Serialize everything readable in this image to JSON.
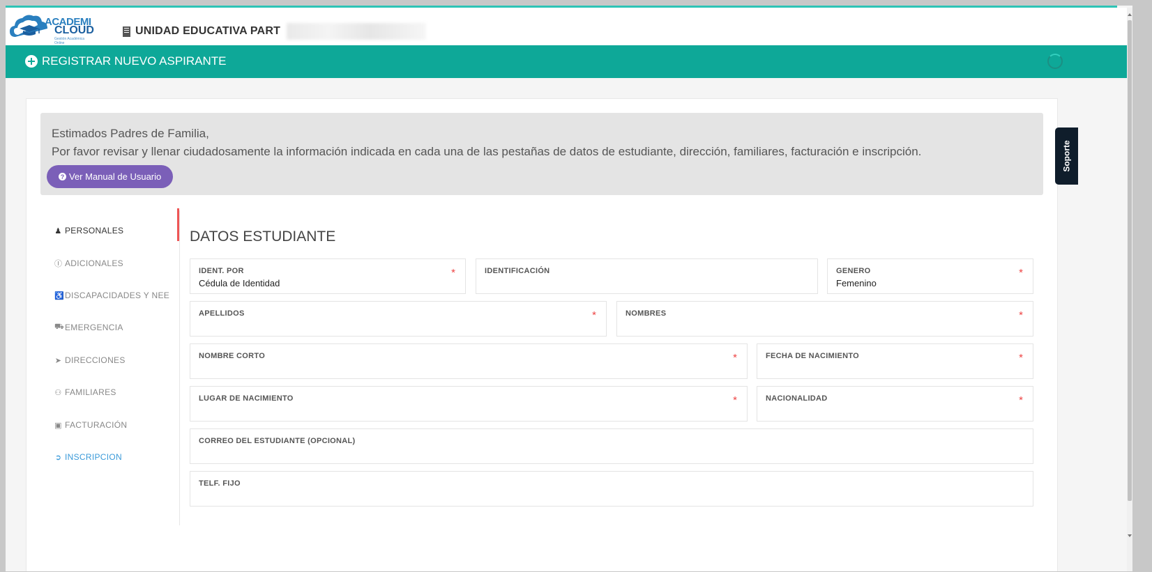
{
  "header": {
    "logo_line1": "ACADEMI",
    "logo_line2": "CLOUD",
    "logo_sub": "Gestión Académica Online",
    "school_name": "UNIDAD EDUCATIVA PART"
  },
  "banner": {
    "title": "REGISTRAR NUEVO ASPIRANTE"
  },
  "notice": {
    "greeting": "Estimados Padres de Familia,",
    "message": "Por favor revisar y llenar ciudadosamente la información indicada en cada una de las pestañas de datos de estudiante, dirección, familiares, facturación e inscripción.",
    "manual_button": "Ver Manual de Usuario"
  },
  "nav": {
    "items": [
      {
        "label": "PERSONALES",
        "icon": "user-icon"
      },
      {
        "label": "ADICIONALES",
        "icon": "info-icon"
      },
      {
        "label": "DISCAPACIDADES Y NEE",
        "icon": "wheelchair-icon"
      },
      {
        "label": "EMERGENCIA",
        "icon": "ambulance-icon"
      },
      {
        "label": "DIRECCIONES",
        "icon": "location-arrow-icon"
      },
      {
        "label": "FAMILIARES",
        "icon": "users-icon"
      },
      {
        "label": "FACTURACIÓN",
        "icon": "money-icon"
      },
      {
        "label": "INSCRIPCION",
        "icon": "arrow-circle-icon"
      }
    ]
  },
  "form": {
    "title": "DATOS ESTUDIANTE",
    "fields": {
      "ident_por": {
        "label": "IDENT. POR",
        "value": "Cédula de Identidad"
      },
      "identificacion": {
        "label": "IDENTIFICACIÓN",
        "value": ""
      },
      "genero": {
        "label": "GENERO",
        "value": "Femenino"
      },
      "apellidos": {
        "label": "APELLIDOS",
        "value": ""
      },
      "nombres": {
        "label": "NOMBRES",
        "value": ""
      },
      "nombre_corto": {
        "label": "NOMBRE CORTO",
        "value": ""
      },
      "fecha_nacimiento": {
        "label": "FECHA DE NACIMIENTO",
        "value": ""
      },
      "lugar_nacimiento": {
        "label": "LUGAR DE NACIMIENTO",
        "value": ""
      },
      "nacionalidad": {
        "label": "NACIONALIDAD",
        "value": ""
      },
      "correo": {
        "label": "CORREO DEL ESTUDIANTE (OPCIONAL)",
        "value": ""
      },
      "telf_fijo": {
        "label": "TELF. FIJO",
        "value": ""
      }
    },
    "required_mark": "*"
  },
  "support": {
    "label": "Soporte"
  },
  "colors": {
    "teal": "#0ea898",
    "purple": "#7b5fb8",
    "link_blue": "#3a9ad9",
    "required_red": "#e44",
    "support_bg": "#0f1d2b"
  }
}
